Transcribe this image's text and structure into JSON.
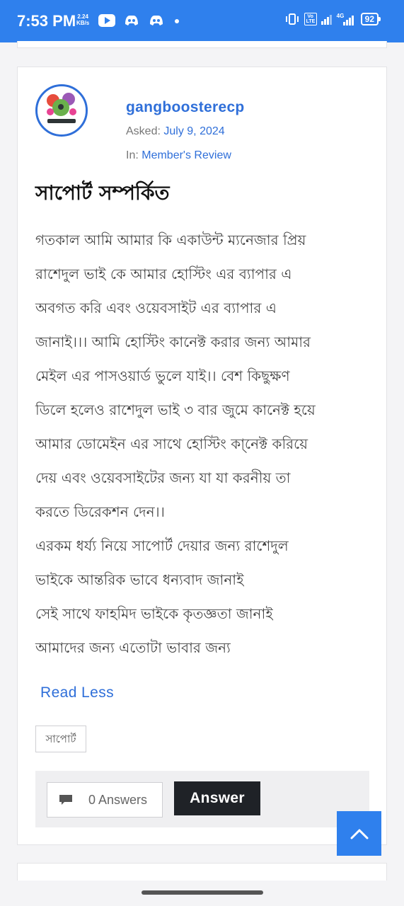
{
  "status_bar": {
    "time": "7:53 PM",
    "speed_value": "2.24",
    "speed_unit": "KB/s",
    "battery": "92",
    "volte": "Vo LTE",
    "network": "4G",
    "icons": [
      "youtube-icon",
      "discord-icon",
      "discord-icon",
      "dot-icon",
      "vibrate-icon",
      "volte-icon",
      "signal-icon",
      "signal-4g-icon",
      "battery-icon"
    ]
  },
  "post": {
    "author": "gangboosterecp",
    "asked_label": "Asked:",
    "asked_date": "July 9, 2024",
    "in_label": "In:",
    "category": "Member's Review",
    "title": "সাপোর্ট সম্পর্কিত",
    "body_lines": [
      "গতকাল আমি আমার কি একাউন্ট ম্যনেজার প্রিয়",
      "রাশেদুল ভাই কে আমার হোস্টিং এর ব্যাপার এ",
      "অবগত করি এবং ওয়েবসাইট এর ব্যাপার এ",
      "জানাই।।। আমি হোস্টিং কানেক্ট করার জন্য আমার",
      "মেইল এর পাসওয়ার্ড ভুলে যাই।। বেশ কিছুক্ষণ",
      "ডিলে হলেও রাশেদুল ভাই ৩ বার জুমে কানেক্ট হয়ে",
      "আমার ডোমেইন এর সাথে হোস্টিং কা্নেক্ট করিয়ে",
      "দেয় এবং ওয়েবসাইটের জন্য যা যা করনীয় তা",
      "করতে ডিরেকশন দেন।।",
      "এরকম ধর্য্য নিয়ে সাপোর্ট দেয়ার জন্য রাশেদুল",
      "ভাইকে আন্তরিক ভাবে ধন্যবাদ জানাই",
      "সেই সাথে ফাহমিদ ভাইকে কৃতজ্ঞতা জানাই",
      "আমাদের জন্য এতোটা ভাবার জন্য"
    ],
    "read_less": "Read Less",
    "tag": "সাপোর্ট",
    "answers_count": "0 Answers",
    "answer_button": "Answer"
  },
  "colors": {
    "status_bar": "#2f80ed",
    "link": "#2f6fd9",
    "dark_button": "#1f2227",
    "scroll_top_button": "#2f80ed"
  }
}
